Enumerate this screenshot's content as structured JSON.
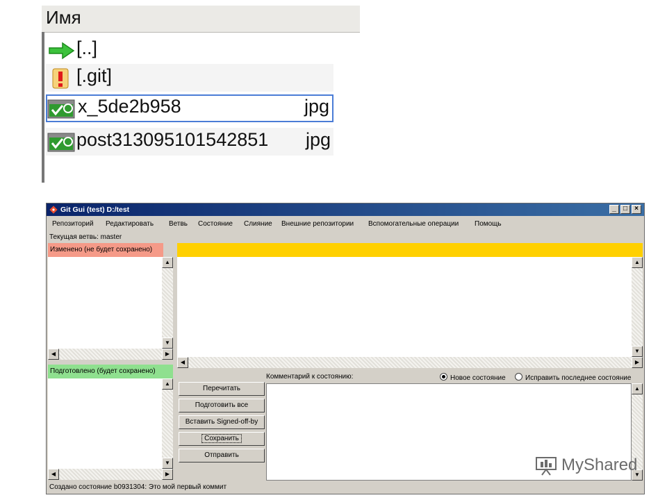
{
  "file_list": {
    "column_header": "Имя",
    "rows": [
      {
        "name": "[..]",
        "ext": "",
        "icon": "green-arrow-icon"
      },
      {
        "name": "[.git]",
        "ext": "",
        "icon": "exclamation-icon"
      },
      {
        "name": "x_5de2b958",
        "ext": "jpg",
        "icon": "git-ok-icon"
      },
      {
        "name": "post313095101542851",
        "ext": "jpg",
        "icon": "git-ok-icon"
      }
    ]
  },
  "window": {
    "title": "Git Gui (test) D:/test",
    "controls": {
      "minimize": "_",
      "maximize": "□",
      "close": "×"
    },
    "menu": [
      "Репозиторий",
      "Редактировать",
      "Ветвь",
      "Состояние",
      "Слияние",
      "Внешние репозитории",
      "Вспомогательные операции",
      "Помощь"
    ],
    "branch_label": "Текущая ветвь: master",
    "unstaged_header": "Изменено (не будет сохранено)",
    "staged_header": "Подготовлено (будет сохранено)",
    "comment_label": "Комментарий к состоянию:",
    "radio_new": "Новое состояние",
    "radio_amend": "Исправить последнее состояние",
    "buttons": {
      "rescan": "Перечитать",
      "stage_all": "Подготовить все",
      "signoff": "Вставить Signed-off-by",
      "commit": "Сохранить",
      "push": "Отправить"
    },
    "status": "Создано состояние b0931304: Это мой первый коммит"
  },
  "watermark": "MyShared",
  "colors": {
    "unstaged": "#f59a88",
    "staged": "#8fe08f",
    "diff_header": "#ffd000",
    "titlebar": "#0a246a"
  }
}
